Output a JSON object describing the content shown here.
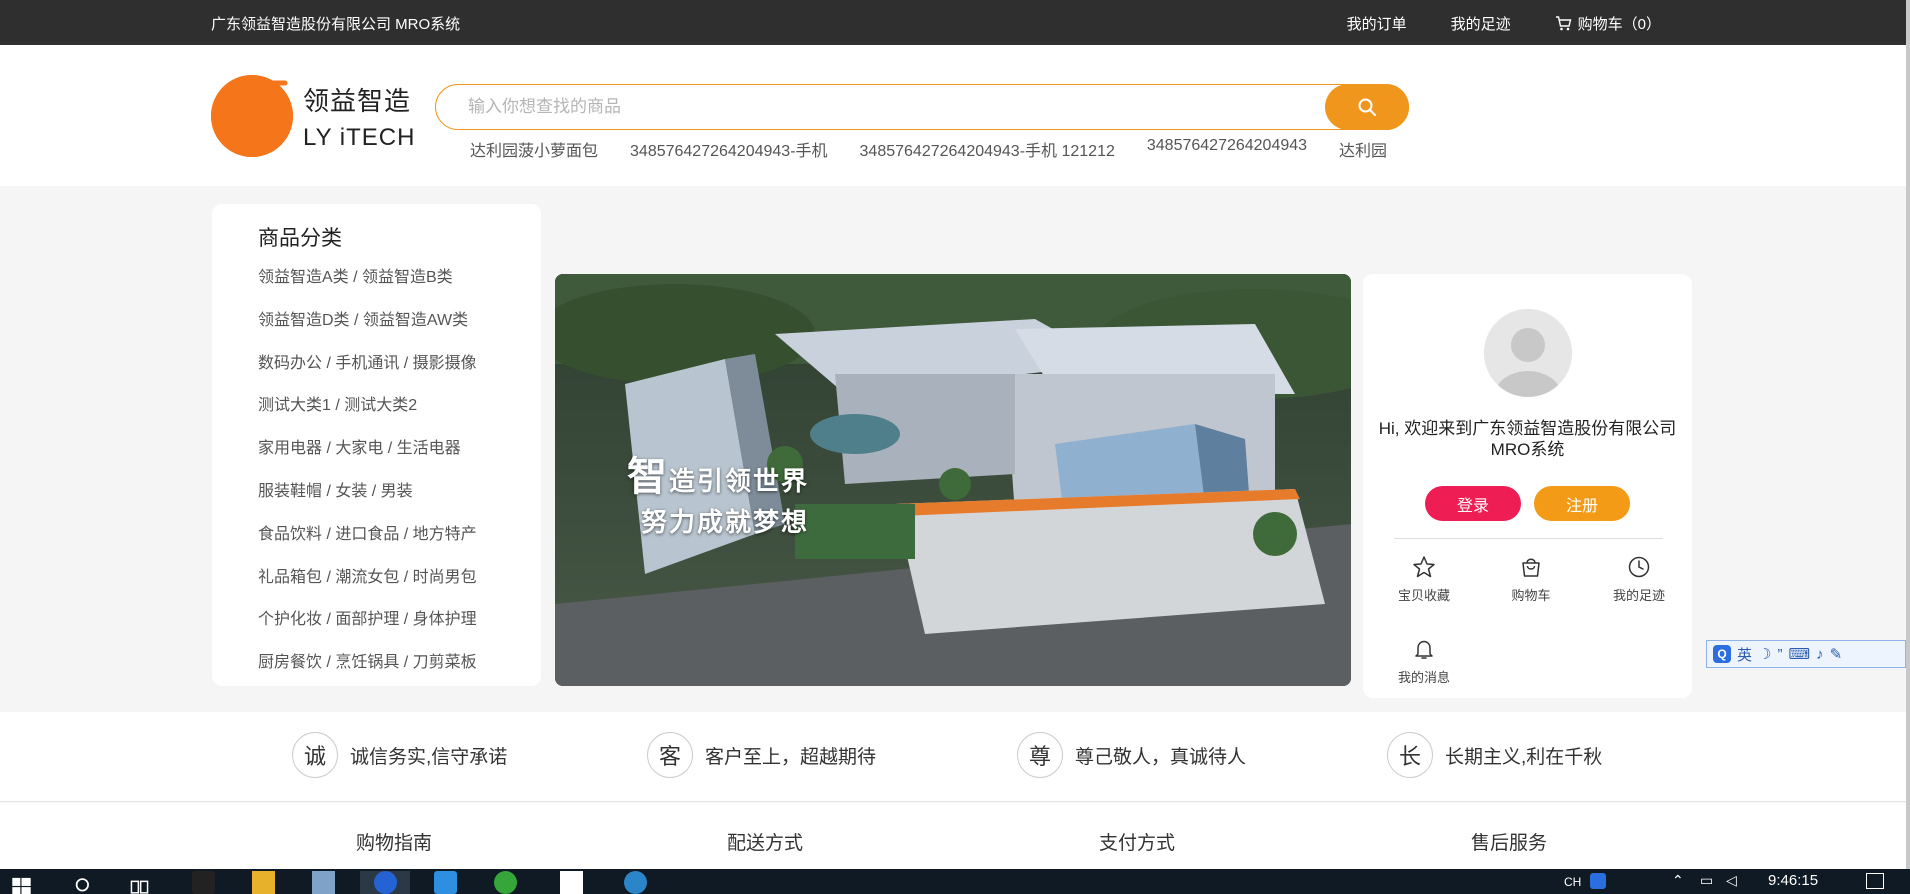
{
  "topbar": {
    "company": "广东领益智造股份有限公司 MRO系统",
    "my_orders": "我的订单",
    "my_footprints": "我的足迹",
    "cart": "购物车（0）"
  },
  "logo": {
    "cn": "领益智造",
    "en": "LY iTECH"
  },
  "search": {
    "placeholder": "输入你想查找的商品",
    "hot_keywords": [
      "达利园菠小萝面包",
      "348576427264204943-手机",
      "348576427264204943-手机 121212",
      "348576427264204943",
      "达利园"
    ]
  },
  "category": {
    "title": "商品分类",
    "items": [
      "领益智造A类 / 领益智造B类",
      "领益智造D类 / 领益智造AW类",
      "数码办公 / 手机通讯 / 摄影摄像",
      "测试大类1 / 测试大类2",
      "家用电器 / 大家电 / 生活电器",
      "服装鞋帽 / 女装 / 男装",
      "食品饮料 / 进口食品 / 地方特产",
      "礼品箱包 / 潮流女包 / 时尚男包",
      "个护化妆 / 面部护理 / 身体护理",
      "厨房餐饮 / 烹饪锅具 / 刀剪菜板"
    ]
  },
  "banner": {
    "line1_big": "智",
    "line1_rest": "造引领世界",
    "line2": "努力成就梦想"
  },
  "user": {
    "welcome": "Hi, 欢迎来到广东领益智造股份有限公司MRO系统",
    "login": "登录",
    "register": "注册",
    "quick": {
      "favorites": "宝贝收藏",
      "cart": "购物车",
      "footprints": "我的足迹",
      "messages": "我的消息"
    }
  },
  "ime": {
    "lang": "英"
  },
  "values": [
    {
      "char": "诚",
      "text": "诚信务实,信守承诺"
    },
    {
      "char": "客",
      "text": "客户至上，超越期待"
    },
    {
      "char": "尊",
      "text": "尊己敬人，真诚待人"
    },
    {
      "char": "长",
      "text": "长期主义,利在千秋"
    }
  ],
  "footer_links": [
    "购物指南",
    "配送方式",
    "支付方式",
    "售后服务"
  ],
  "taskbar": {
    "clock": "9:46:15",
    "ime_tray": "CH"
  },
  "colors": {
    "brand_orange": "#f0961d",
    "login_red": "#ee1e54",
    "topbar": "#2f2f2f"
  }
}
